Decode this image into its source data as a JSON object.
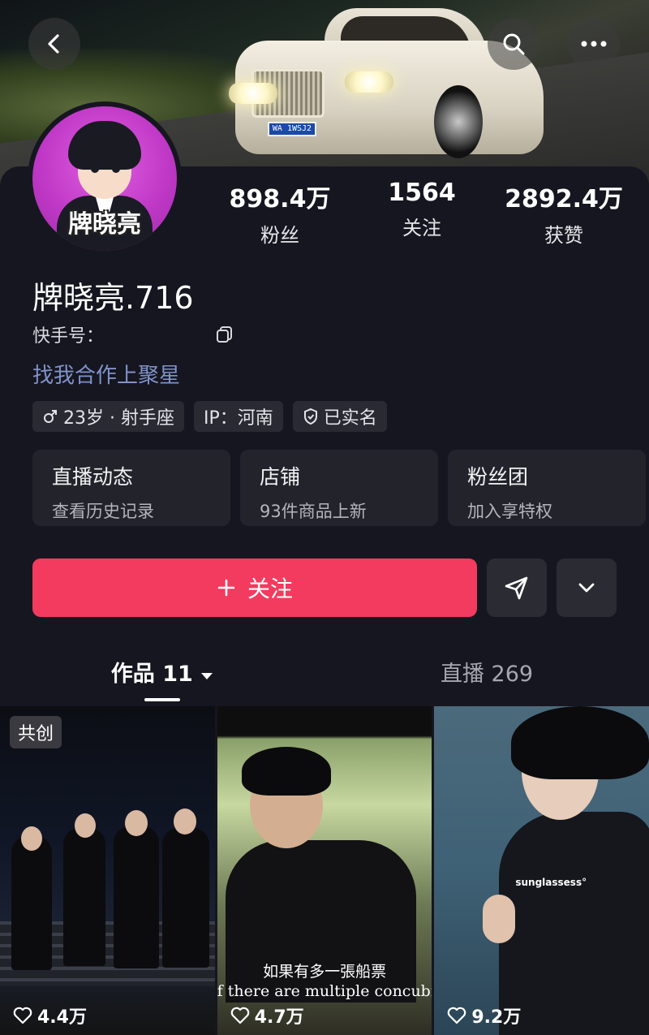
{
  "header": {
    "plate_text": "WA 1WSJ2"
  },
  "profile": {
    "avatar_name": "牌晓亮",
    "stats": [
      {
        "value": "898.4万",
        "label": "粉丝"
      },
      {
        "value": "1564",
        "label": "关注"
      },
      {
        "value": "2892.4万",
        "label": "获赞"
      }
    ],
    "username": "牌晓亮.716",
    "ks_id_label": "快手号：",
    "collab_link": "找我合作上聚星",
    "tags": [
      "23岁 · 射手座",
      "IP：河南",
      "已实名"
    ]
  },
  "cards": [
    {
      "title": "直播动态",
      "subtitle": "查看历史记录"
    },
    {
      "title": "店铺",
      "subtitle": "93件商品上新"
    },
    {
      "title": "粉丝团",
      "subtitle": "加入享特权"
    }
  ],
  "actions": {
    "follow_label": "关注"
  },
  "tabs": [
    {
      "label": "作品 11"
    },
    {
      "label": "直播 269"
    }
  ],
  "videos": [
    {
      "badge": "共创",
      "likes": "4.4万"
    },
    {
      "subtitle_cn": "如果有多一張船票",
      "subtitle_en": "f there are multiple concubine",
      "likes": "4.7万"
    },
    {
      "overlay": "sunglassess°",
      "likes": "9.2万"
    }
  ],
  "colors": {
    "accent": "#f23b5e",
    "link": "#7f93c8",
    "background": "#161620"
  }
}
